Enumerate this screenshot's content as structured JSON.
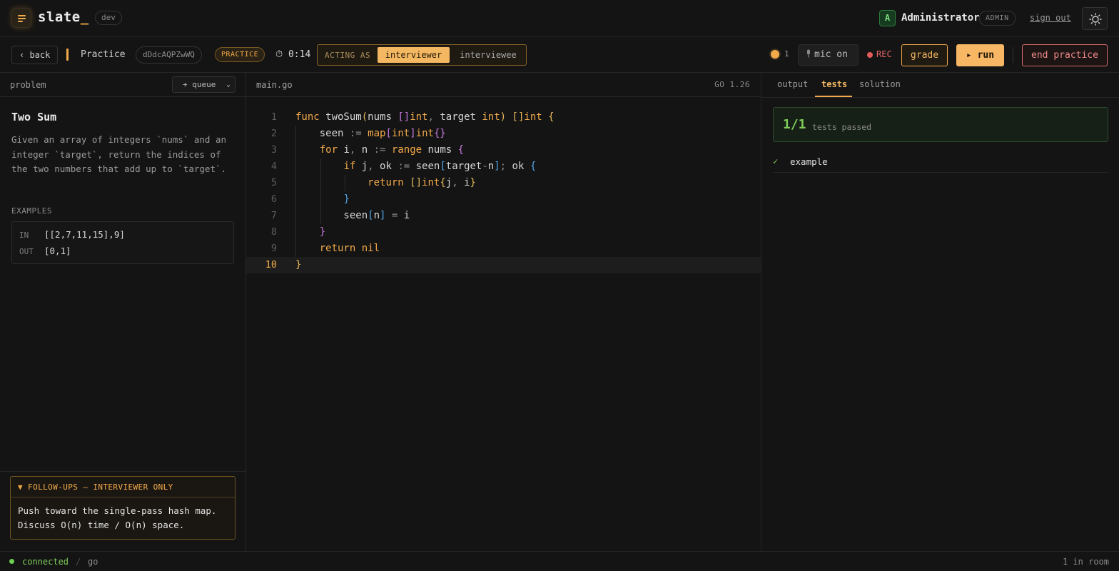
{
  "app": {
    "brand": "slate",
    "brand_suffix": "_",
    "env": "dev"
  },
  "user": {
    "initial": "A",
    "name": "Administrator",
    "role": "ADMIN",
    "sign_out": "sign out"
  },
  "session": {
    "back": "‹ back",
    "title": "Practice",
    "id": "dDdcAQPZwWQ",
    "mode": "PRACTICE",
    "timer": "⏱ 0:14",
    "acting_as_label": "ACTING AS",
    "roles": [
      "interviewer",
      "interviewee"
    ],
    "active_role": "interviewer",
    "presence_count": "1",
    "mic": "mic on",
    "rec": "REC",
    "grade": "grade",
    "run": "▸ run",
    "end": "end practice"
  },
  "problem_panel": {
    "label": "problem",
    "queue": "+ queue",
    "title": "Two Sum",
    "description": "Given an array of integers `nums` and an integer `target`, return the indices of the two numbers that add up to `target`.",
    "examples_label": "EXAMPLES",
    "example": {
      "in_label": "IN",
      "in": "[[2,7,11,15],9]",
      "out_label": "OUT",
      "out": "[0,1]"
    },
    "followups_label": "▼ FOLLOW-UPS — INTERVIEWER ONLY",
    "followups_text": "Push toward the single-pass hash map. Discuss O(n) time / O(n) space."
  },
  "editor": {
    "filename": "main.go",
    "language": "GO 1.26",
    "active_line": 10,
    "lines": [
      "func twoSum(nums []int, target int) []int {",
      "    seen := map[int]int{}",
      "    for i, n := range nums {",
      "        if j, ok := seen[target-n]; ok {",
      "            return []int{j, i}",
      "        }",
      "        seen[n] = i",
      "    }",
      "    return nil",
      "}"
    ]
  },
  "results": {
    "tabs": [
      "output",
      "tests",
      "solution"
    ],
    "active_tab": "tests",
    "passed": "1/1",
    "passed_label": "tests passed",
    "tests": [
      {
        "status": "✓",
        "name": "example"
      }
    ]
  },
  "status": {
    "connection": "connected",
    "separator": "/",
    "language": "go",
    "room": "1 in room"
  },
  "colors": {
    "accent": "#f2a94a",
    "success": "#7ecb5a",
    "danger": "#e25b5b",
    "background": "#131313"
  },
  "icons": [
    "logo-icon",
    "theme-sun-icon",
    "timer-icon",
    "mic-icon",
    "rec-dot-icon",
    "chevron-down-icon",
    "check-icon"
  ]
}
